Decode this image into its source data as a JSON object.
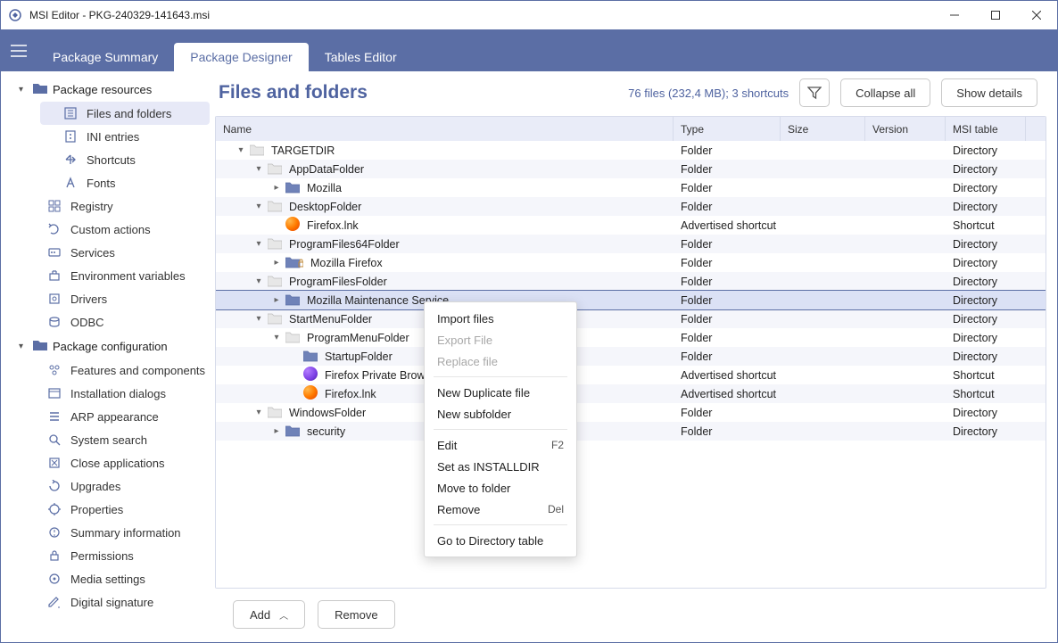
{
  "window": {
    "title": "MSI Editor - PKG-240329-141643.msi"
  },
  "tabs": {
    "summary": "Package Summary",
    "designer": "Package Designer",
    "tables": "Tables Editor"
  },
  "sidebar": {
    "group_resources": "Package resources",
    "group_config": "Package configuration",
    "resources": [
      {
        "label": "Files and folders"
      },
      {
        "label": "INI entries"
      },
      {
        "label": "Shortcuts"
      },
      {
        "label": "Fonts"
      },
      {
        "label": "Registry"
      },
      {
        "label": "Custom actions"
      },
      {
        "label": "Services"
      },
      {
        "label": "Environment variables"
      },
      {
        "label": "Drivers"
      },
      {
        "label": "ODBC"
      }
    ],
    "config": [
      {
        "label": "Features and components"
      },
      {
        "label": "Installation dialogs"
      },
      {
        "label": "ARP appearance"
      },
      {
        "label": "System search"
      },
      {
        "label": "Close applications"
      },
      {
        "label": "Upgrades"
      },
      {
        "label": "Properties"
      },
      {
        "label": "Summary information"
      },
      {
        "label": "Permissions"
      },
      {
        "label": "Media settings"
      },
      {
        "label": "Digital signature"
      }
    ]
  },
  "content": {
    "title": "Files and folders",
    "stats": "76 files (232,4 MB); 3 shortcuts",
    "collapse": "Collapse all",
    "showdetails": "Show details"
  },
  "columns": {
    "name": "Name",
    "type": "Type",
    "size": "Size",
    "version": "Version",
    "table": "MSI table"
  },
  "rows": [
    {
      "indent": 0,
      "chev": "down",
      "icon": "folder",
      "name": "TARGETDIR",
      "type": "Folder",
      "table": "Directory"
    },
    {
      "indent": 1,
      "chev": "down",
      "icon": "folder",
      "name": "AppDataFolder",
      "type": "Folder",
      "table": "Directory"
    },
    {
      "indent": 2,
      "chev": "right",
      "icon": "folder-blue",
      "name": "Mozilla",
      "type": "Folder",
      "table": "Directory"
    },
    {
      "indent": 1,
      "chev": "down",
      "icon": "folder",
      "name": "DesktopFolder",
      "type": "Folder",
      "table": "Directory"
    },
    {
      "indent": 2,
      "chev": "",
      "icon": "firefox",
      "name": "Firefox.lnk",
      "type": "Advertised shortcut",
      "table": "Shortcut"
    },
    {
      "indent": 1,
      "chev": "down",
      "icon": "folder",
      "name": "ProgramFiles64Folder",
      "type": "Folder",
      "table": "Directory"
    },
    {
      "indent": 2,
      "chev": "right",
      "icon": "folder-lock",
      "name": "Mozilla Firefox",
      "type": "Folder",
      "table": "Directory"
    },
    {
      "indent": 1,
      "chev": "down",
      "icon": "folder",
      "name": "ProgramFilesFolder",
      "type": "Folder",
      "table": "Directory"
    },
    {
      "indent": 2,
      "chev": "right",
      "icon": "folder-blue",
      "name": "Mozilla Maintenance Service",
      "type": "Folder",
      "table": "Directory",
      "selected": true
    },
    {
      "indent": 1,
      "chev": "down",
      "icon": "folder",
      "name": "StartMenuFolder",
      "type": "Folder",
      "table": "Directory"
    },
    {
      "indent": 2,
      "chev": "down",
      "icon": "folder",
      "name": "ProgramMenuFolder",
      "type": "Folder",
      "table": "Directory"
    },
    {
      "indent": 3,
      "chev": "",
      "icon": "folder-blue",
      "name": "StartupFolder",
      "type": "Folder",
      "table": "Directory"
    },
    {
      "indent": 3,
      "chev": "",
      "icon": "firefox-priv",
      "name": "Firefox Private Browsing.lnk",
      "type": "Advertised shortcut",
      "table": "Shortcut"
    },
    {
      "indent": 3,
      "chev": "",
      "icon": "firefox",
      "name": "Firefox.lnk",
      "type": "Advertised shortcut",
      "table": "Shortcut"
    },
    {
      "indent": 1,
      "chev": "down",
      "icon": "folder",
      "name": "WindowsFolder",
      "type": "Folder",
      "table": "Directory"
    },
    {
      "indent": 2,
      "chev": "right",
      "icon": "folder-blue",
      "name": "security",
      "type": "Folder",
      "table": "Directory"
    }
  ],
  "footer": {
    "add": "Add",
    "remove": "Remove"
  },
  "menu": {
    "import": "Import files",
    "export": "Export File",
    "replace": "Replace file",
    "newdup": "New Duplicate file",
    "newsub": "New subfolder",
    "edit": "Edit",
    "edit_sc": "F2",
    "setinstall": "Set as INSTALLDIR",
    "move": "Move to folder",
    "remove": "Remove",
    "remove_sc": "Del",
    "goto": "Go to Directory table"
  }
}
